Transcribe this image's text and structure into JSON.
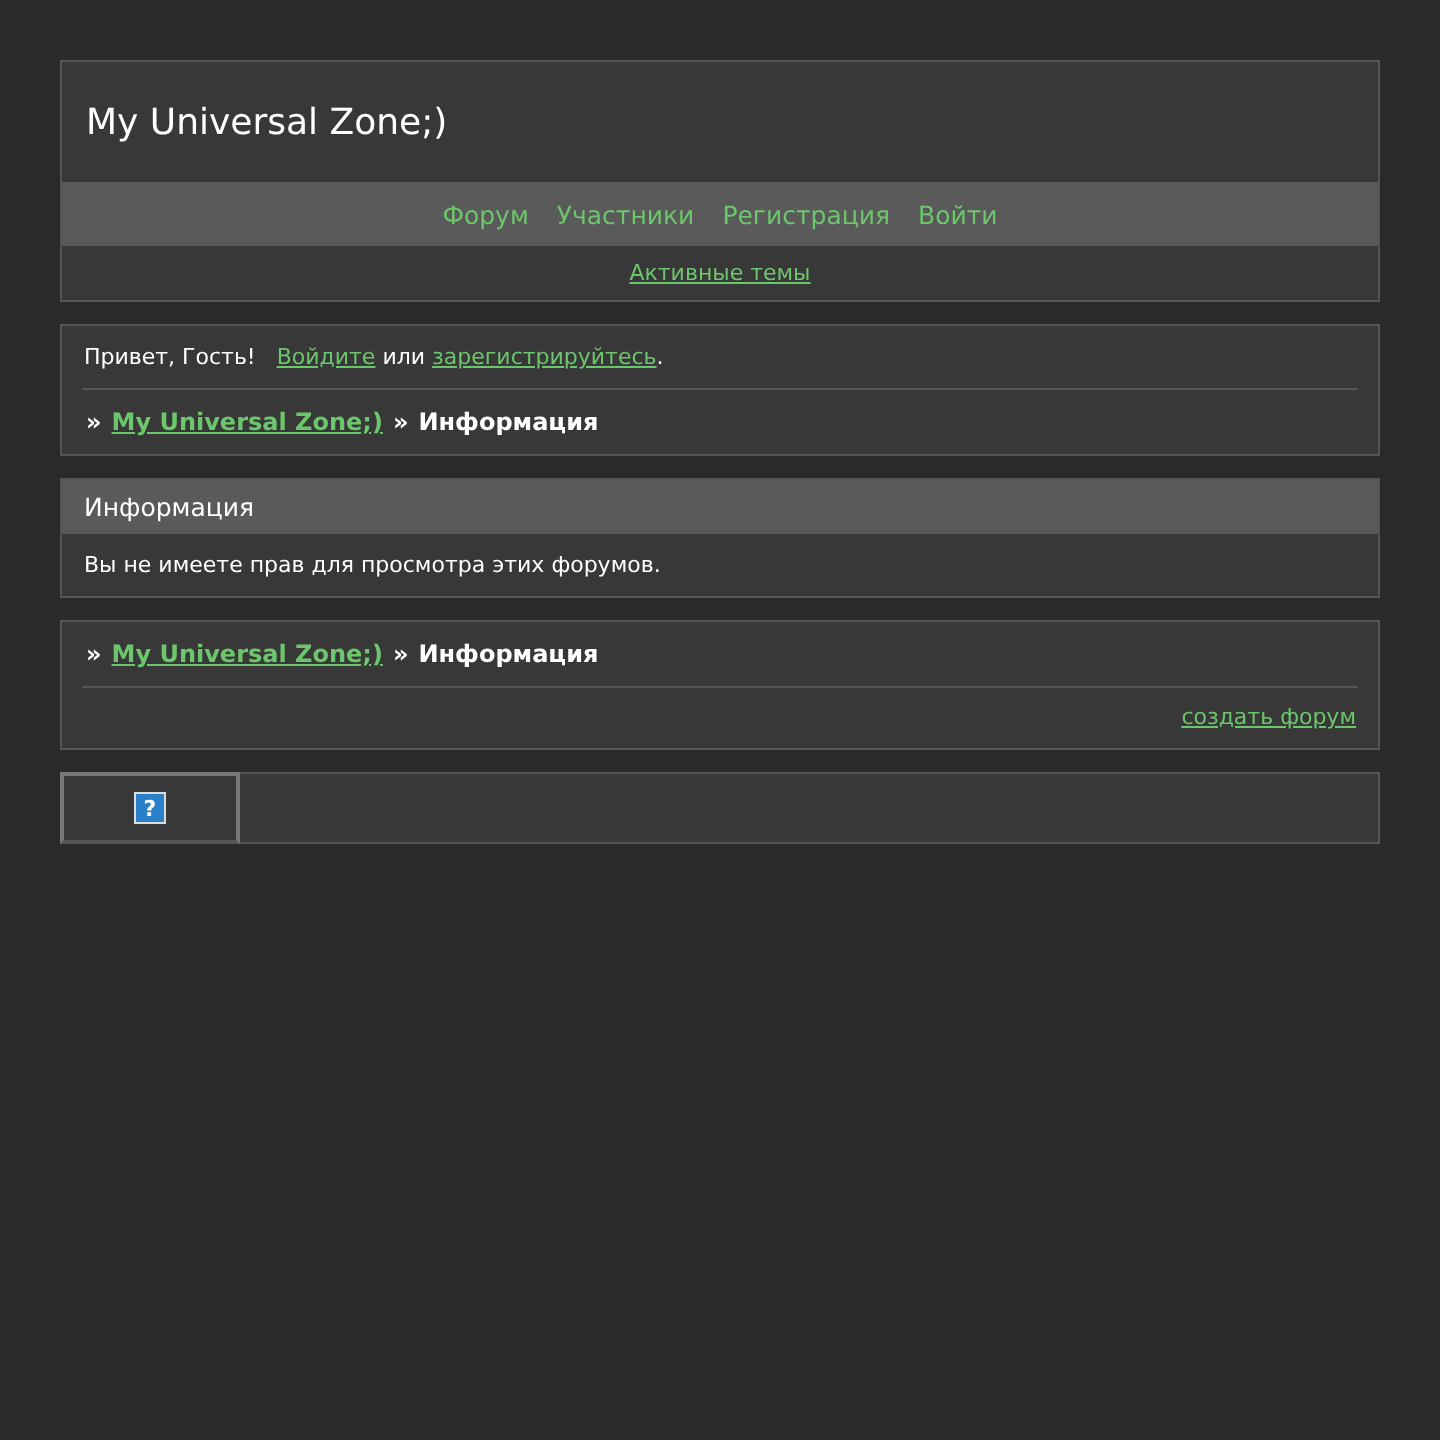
{
  "header": {
    "title": "My Universal Zone;)"
  },
  "nav": {
    "items": [
      "Форум",
      "Участники",
      "Регистрация",
      "Войти"
    ]
  },
  "subnav": {
    "link": "Активные темы"
  },
  "welcome": {
    "prefix": "Привет, Гость!",
    "login_link": "Войдите",
    "middle": "или",
    "register_link": "зарегистрируйтесь",
    "suffix": "."
  },
  "breadcrumb_top": [
    {
      "separator": "»",
      "label": "My Universal Zone;)",
      "kind": "link"
    },
    {
      "separator": "»",
      "label": "Информация",
      "kind": "current"
    }
  ],
  "info_panel": {
    "title": "Информация",
    "message": "Вы не имеете прав для просмотра этих форумов."
  },
  "breadcrumb_bottom": [
    {
      "separator": "»",
      "label": "My Universal Zone;)",
      "kind": "link"
    },
    {
      "separator": "»",
      "label": "Информация",
      "kind": "current"
    }
  ],
  "footer_link": "создать форум",
  "badge": {
    "glyph": "?"
  }
}
